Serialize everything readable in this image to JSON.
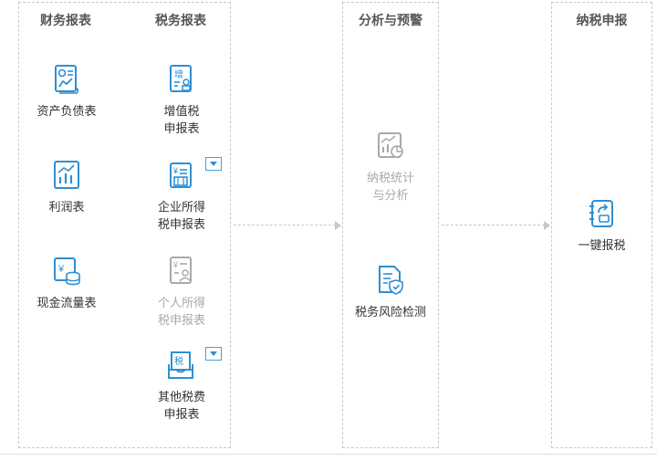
{
  "columns": {
    "financial": {
      "title": "财务报表"
    },
    "tax": {
      "title": "税务报表"
    },
    "analysis": {
      "title": "分析与预警"
    },
    "filing": {
      "title": "纳税申报"
    }
  },
  "financial_items": [
    {
      "line1": "资产负债表",
      "icon": "balance-sheet-icon"
    },
    {
      "line1": "利润表",
      "icon": "profit-chart-icon"
    },
    {
      "line1": "现金流量表",
      "icon": "cash-flow-icon"
    }
  ],
  "tax_items": [
    {
      "line1": "增值税",
      "line2": "申报表",
      "icon": "vat-icon"
    },
    {
      "line1": "企业所得",
      "line2": "税申报表",
      "icon": "corporate-tax-icon"
    },
    {
      "line1": "个人所得",
      "line2": "税申报表",
      "icon": "personal-tax-icon"
    },
    {
      "line1": "其他税费",
      "line2": "申报表",
      "icon": "other-tax-icon"
    }
  ],
  "analysis_items": [
    {
      "line1": "纳税统计",
      "line2": "与分析",
      "icon": "tax-statistics-icon"
    },
    {
      "line1": "税务风险检测",
      "icon": "risk-check-icon"
    }
  ],
  "filing_items": [
    {
      "line1": "一键报税",
      "icon": "one-click-filing-icon"
    }
  ],
  "icon_glyphs": {
    "vat": "增",
    "yen": "¥",
    "tax": "税"
  },
  "colors": {
    "accent": "#2e8fd3",
    "disabled": "#a9a9a9",
    "border": "#c8c8c8",
    "text": "#333333"
  }
}
